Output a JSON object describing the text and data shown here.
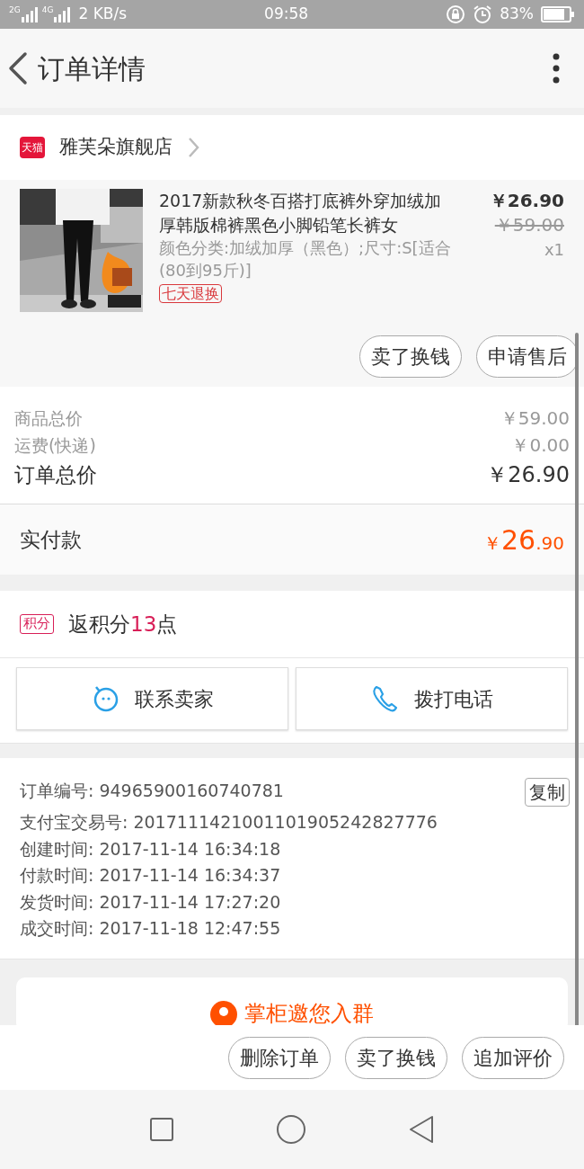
{
  "status_bar": {
    "signal_labels": [
      "2G",
      "4G"
    ],
    "speed": "2 KB/s",
    "time": "09:58",
    "battery": "83%"
  },
  "header": {
    "title": "订单详情"
  },
  "shop": {
    "badge": "天猫",
    "name": "雅芙朵旗舰店"
  },
  "product": {
    "title": "2017新款秋冬百搭打底裤外穿加绒加厚韩版棉裤黑色小脚铅笔长裤女",
    "sku": "颜色分类:加绒加厚（黑色）;尺寸:S[适合(80到95斤)]",
    "tag": "七天退换",
    "price": "￥26.90",
    "original_price": "￥59.00",
    "quantity": "x1",
    "actions": [
      "卖了换钱",
      "申请售后"
    ]
  },
  "summary": [
    {
      "label": "商品总价",
      "value": "￥59.00",
      "kind": "minor"
    },
    {
      "label": "运费(快递)",
      "value": "￥0.00",
      "kind": "minor"
    },
    {
      "label": "订单总价",
      "value": "￥26.90",
      "kind": "total"
    }
  ],
  "paid": {
    "label": "实付款",
    "currency": "￥",
    "integer": "26",
    "decimal": ".90"
  },
  "points": {
    "badge": "积分",
    "prefix": "返积分",
    "number": "13",
    "suffix": "点"
  },
  "contact": [
    {
      "label": "联系卖家",
      "kind": "chat"
    },
    {
      "label": "拨打电话",
      "kind": "phone"
    }
  ],
  "order_info": {
    "copy_button": "复制",
    "rows": [
      {
        "label": "订单编号:",
        "value": "94965900160740781"
      },
      {
        "label": "支付宝交易号:",
        "value": "2017111421001101905242827776"
      },
      {
        "label": "创建时间:",
        "value": "2017-11-14 16:34:18"
      },
      {
        "label": "付款时间:",
        "value": "2017-11-14 16:34:37"
      },
      {
        "label": "发货时间:",
        "value": "2017-11-14 17:27:20"
      },
      {
        "label": "成交时间:",
        "value": "2017-11-18 12:47:55"
      }
    ]
  },
  "group_banner": {
    "text": "掌柜邀您入群"
  },
  "bottom_actions": [
    "删除订单",
    "卖了换钱",
    "追加评价"
  ]
}
